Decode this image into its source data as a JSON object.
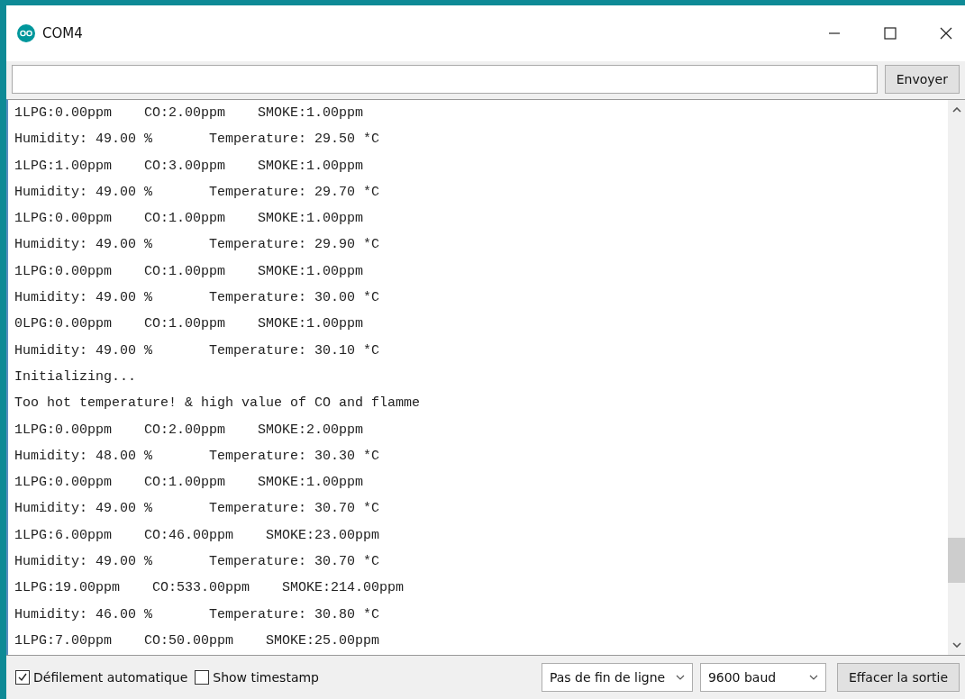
{
  "window": {
    "title": "COM4"
  },
  "send": {
    "button": "Envoyer"
  },
  "output": {
    "lines": [
      "1LPG:0.00ppm    CO:2.00ppm    SMOKE:1.00ppm",
      "Humidity: 49.00 %       Temperature: 29.50 *C",
      "1LPG:1.00ppm    CO:3.00ppm    SMOKE:1.00ppm",
      "Humidity: 49.00 %       Temperature: 29.70 *C",
      "1LPG:0.00ppm    CO:1.00ppm    SMOKE:1.00ppm",
      "Humidity: 49.00 %       Temperature: 29.90 *C",
      "1LPG:0.00ppm    CO:1.00ppm    SMOKE:1.00ppm",
      "Humidity: 49.00 %       Temperature: 30.00 *C",
      "0LPG:0.00ppm    CO:1.00ppm    SMOKE:1.00ppm",
      "Humidity: 49.00 %       Temperature: 30.10 *C",
      "Initializing...",
      "Too hot temperature! & high value of CO and flamme",
      "1LPG:0.00ppm    CO:2.00ppm    SMOKE:2.00ppm",
      "Humidity: 48.00 %       Temperature: 30.30 *C",
      "1LPG:0.00ppm    CO:1.00ppm    SMOKE:1.00ppm",
      "Humidity: 49.00 %       Temperature: 30.70 *C",
      "1LPG:6.00ppm    CO:46.00ppm    SMOKE:23.00ppm",
      "Humidity: 49.00 %       Temperature: 30.70 *C",
      "1LPG:19.00ppm    CO:533.00ppm    SMOKE:214.00ppm",
      "Humidity: 46.00 %       Temperature: 30.80 *C",
      "1LPG:7.00ppm    CO:50.00ppm    SMOKE:25.00ppm"
    ]
  },
  "footer": {
    "checkboxes": [
      {
        "label": "Défilement automatique",
        "checked": true
      },
      {
        "label": "Show timestamp",
        "checked": false
      }
    ],
    "dropdowns": [
      {
        "value": "Pas de fin de ligne"
      },
      {
        "value": "9600 baud"
      }
    ],
    "button": "Effacer la sortie"
  }
}
